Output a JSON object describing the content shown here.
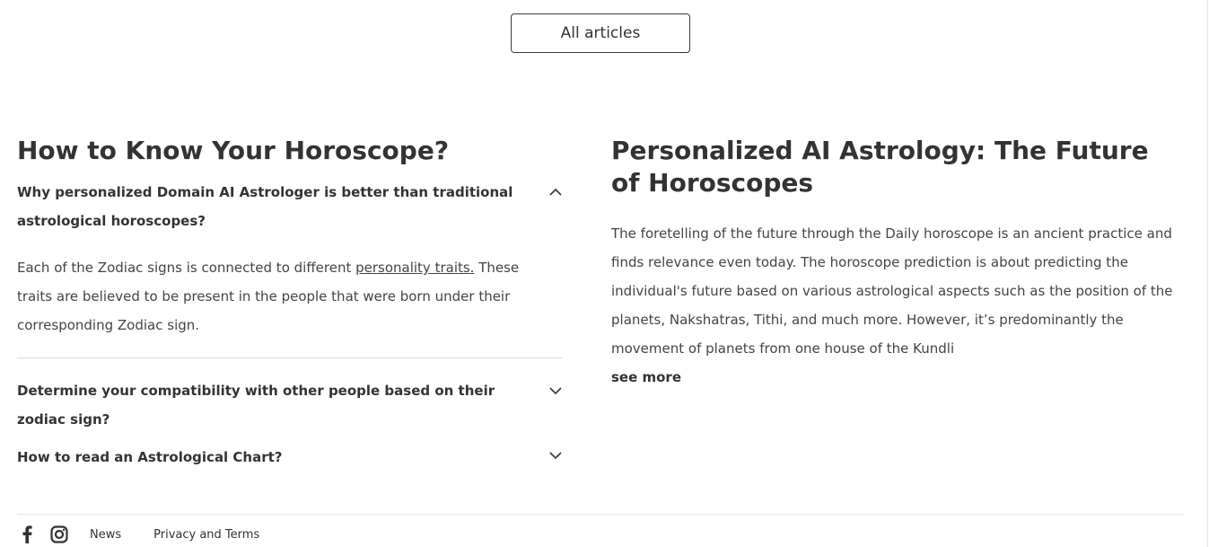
{
  "top": {
    "all_articles_label": "All articles"
  },
  "faq": {
    "title": "How to Know Your Horoscope?",
    "items": [
      {
        "question": "Why personalized Domain AI Astrologer is better than traditional astrological horoscopes?",
        "expanded": true,
        "answer_before_link": "Each of the Zodiac signs is connected to different ",
        "answer_link": "personality traits.",
        "answer_after_link": " These traits are believed to be present in the people that were born under their corresponding Zodiac sign."
      },
      {
        "question": "Determine your compatibility with other people based on their zodiac sign?",
        "expanded": false
      },
      {
        "question": "How to read an Astrological Chart?",
        "expanded": false
      }
    ]
  },
  "article": {
    "title": "Personalized AI Astrology: The Future of Horoscopes",
    "body": "The foretelling of the future through the Daily horoscope is an ancient practice and finds relevance even today. The horoscope prediction is about predicting the individual's future based on various astrological aspects such as the position of the planets, Nakshatras, Tithi, and much more. However, it’s predominantly the movement of planets from one house of the Kundli",
    "see_more_label": "see more"
  },
  "footer": {
    "social_icons": [
      "facebook-icon",
      "instagram-icon"
    ],
    "links": [
      "News",
      "Privacy and Terms"
    ]
  },
  "colors": {
    "text": "#333333",
    "divider": "#dcdcdc",
    "background": "#ffffff"
  }
}
